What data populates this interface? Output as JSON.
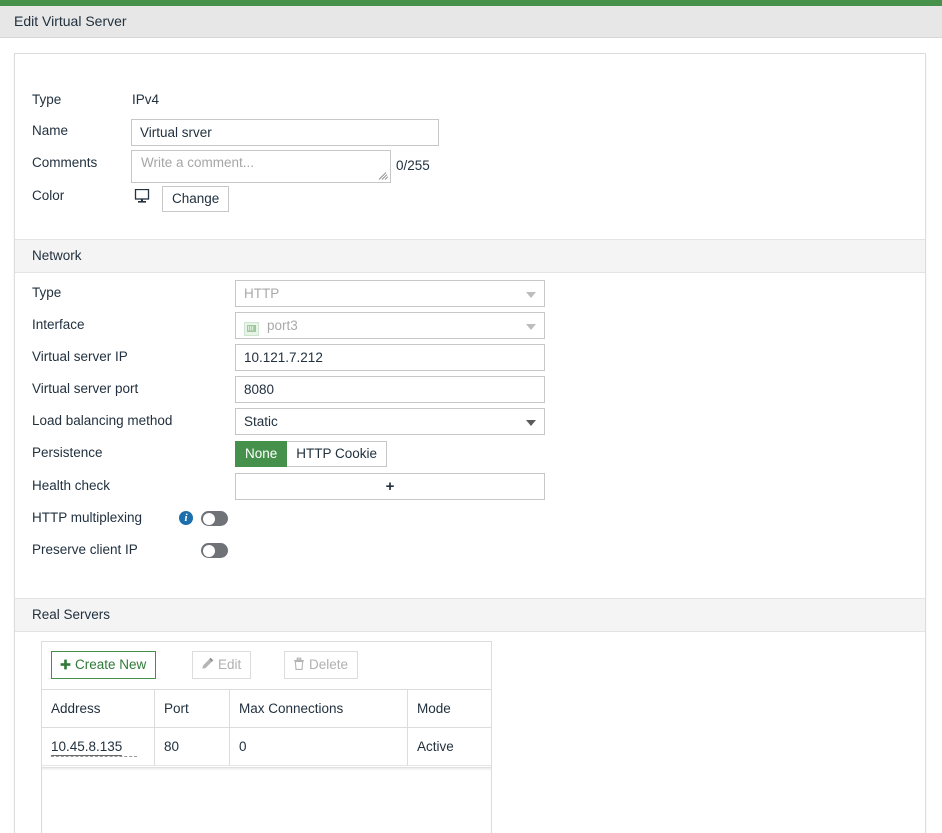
{
  "window": {
    "title": "Edit Virtual Server",
    "accent_color": "#46924a"
  },
  "general": {
    "type_label": "Type",
    "type_value": "IPv4",
    "name_label": "Name",
    "name_value": "Virtual srver",
    "comments_label": "Comments",
    "comments_value": "",
    "comments_placeholder": "Write a comment...",
    "comments_counter": "0/255",
    "color_label": "Color",
    "color_icon": "monitor-icon",
    "color_change_button": "Change"
  },
  "network": {
    "section_title": "Network",
    "type_label": "Type",
    "type_value": "HTTP",
    "type_disabled": true,
    "interface_label": "Interface",
    "interface_value": "port3",
    "interface_icon": "ethernet-port-icon",
    "interface_disabled": true,
    "vip_label": "Virtual server IP",
    "vip_value": "10.121.7.212",
    "vport_label": "Virtual server port",
    "vport_value": "8080",
    "lb_label": "Load balancing method",
    "lb_value": "Static",
    "persistence_label": "Persistence",
    "persistence_options": [
      "None",
      "HTTP Cookie"
    ],
    "persistence_selected": "None",
    "health_check_label": "Health check",
    "health_check_add": "+",
    "http_mux_label": "HTTP multiplexing",
    "http_mux_info_icon": "info-icon",
    "http_mux_enabled": false,
    "preserve_ip_label": "Preserve client IP",
    "preserve_ip_enabled": false
  },
  "real_servers": {
    "section_title": "Real Servers",
    "toolbar": {
      "create_new": "Create New",
      "edit": "Edit",
      "delete": "Delete"
    },
    "columns": [
      "Address",
      "Port",
      "Max Connections",
      "Mode"
    ],
    "rows": [
      {
        "address": "10.45.8.135",
        "port": "80",
        "max_connections": "0",
        "mode": "Active"
      }
    ]
  }
}
